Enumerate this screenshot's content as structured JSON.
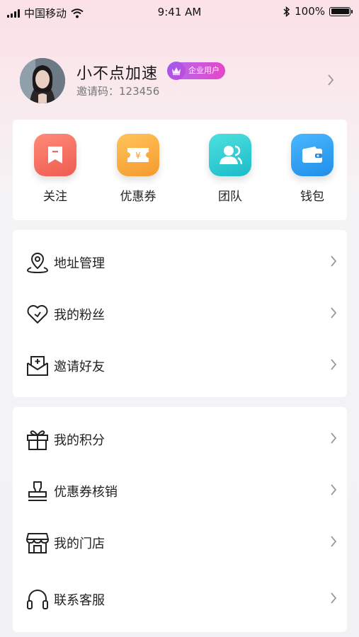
{
  "status_bar": {
    "carrier": "中国移动",
    "time": "9:41 AM",
    "battery": "100%",
    "battery_level": 1.0
  },
  "profile": {
    "name": "小不点加速",
    "badge": "企业用户",
    "invite_code": "邀请码：123456"
  },
  "quick_actions": [
    {
      "label": "关注",
      "icon": "bookmark-icon",
      "color": "#f26c5f"
    },
    {
      "label": "优惠券",
      "icon": "coupon-icon",
      "color": "#f9a53a"
    },
    {
      "label": "团队",
      "icon": "team-icon",
      "color": "#2ecdd3"
    },
    {
      "label": "钱包",
      "icon": "wallet-icon",
      "color": "#2a9ef2"
    }
  ],
  "menu_group_1": [
    {
      "label": "地址管理",
      "icon": "location-pin-icon"
    },
    {
      "label": "我的粉丝",
      "icon": "heart-icon"
    },
    {
      "label": "邀请好友",
      "icon": "invite-envelope-icon"
    }
  ],
  "menu_group_2": [
    {
      "label": "我的积分",
      "icon": "gift-icon"
    },
    {
      "label": "优惠券核销",
      "icon": "stamp-icon"
    },
    {
      "label": "我的门店",
      "icon": "store-icon"
    },
    {
      "label": "联系客服",
      "icon": "headset-icon"
    }
  ]
}
